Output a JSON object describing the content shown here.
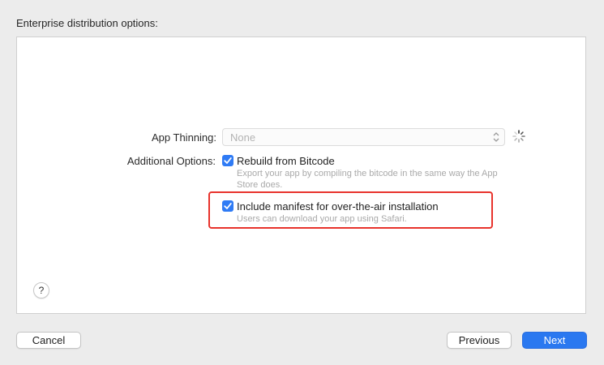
{
  "header": {
    "title": "Enterprise distribution options:"
  },
  "app_thinning": {
    "label": "App Thinning:",
    "value": "None"
  },
  "additional_options": {
    "label": "Additional Options:",
    "options": [
      {
        "label": "Rebuild from Bitcode",
        "checked": true,
        "description": "Export your app by compiling the bitcode in the same way the App Store does."
      },
      {
        "label": "Include manifest for over-the-air installation",
        "checked": true,
        "description": "Users can download your app using Safari."
      }
    ]
  },
  "help": {
    "label": "?"
  },
  "footer": {
    "cancel_label": "Cancel",
    "previous_label": "Previous",
    "next_label": "Next"
  },
  "colors": {
    "accent": "#2a78f0",
    "highlight": "#e8332c"
  }
}
